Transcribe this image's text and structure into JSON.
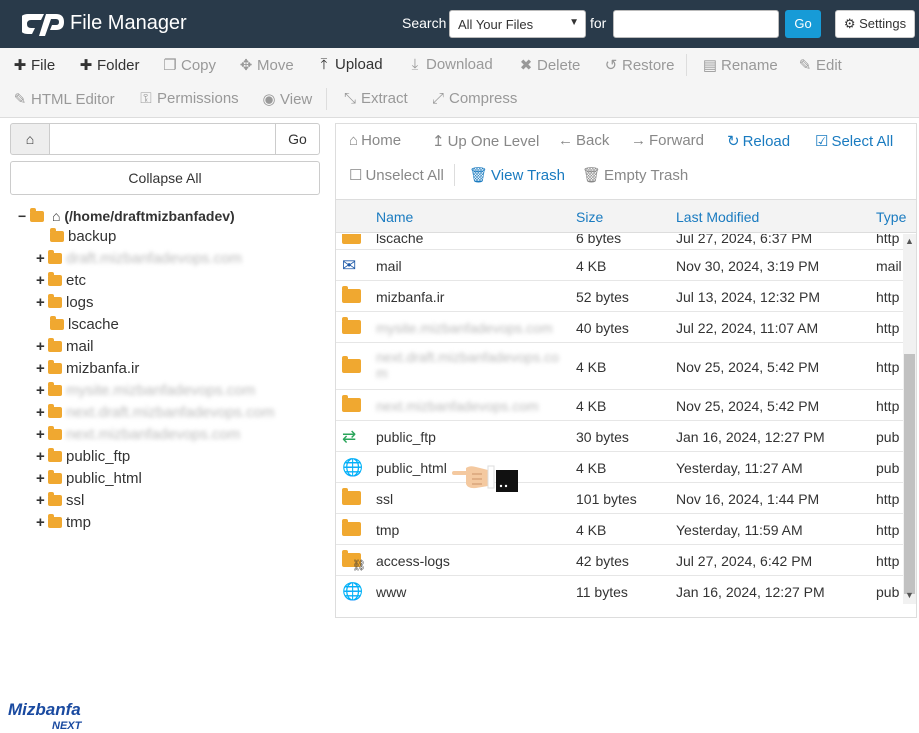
{
  "header": {
    "title": "File Manager",
    "search_label": "Search",
    "search_select": "All Your Files",
    "for_label": "for",
    "go_label": "Go",
    "settings_label": "Settings"
  },
  "toolbar": {
    "row1": [
      {
        "label": "File",
        "icon": "plus-icon",
        "state": "active"
      },
      {
        "label": "Folder",
        "icon": "plus-icon",
        "state": "active"
      },
      {
        "label": "Copy",
        "icon": "copy-icon",
        "state": "disabled"
      },
      {
        "label": "Move",
        "icon": "move-icon",
        "state": "disabled"
      },
      {
        "label": "Upload",
        "icon": "upload-icon",
        "state": "active"
      },
      {
        "label": "Download",
        "icon": "download-icon",
        "state": "disabled"
      },
      {
        "label": "Delete",
        "icon": "delete-icon",
        "state": "disabled"
      },
      {
        "label": "Restore",
        "icon": "restore-icon",
        "state": "disabled"
      },
      {
        "label": "Rename",
        "icon": "rename-icon",
        "state": "disabled"
      },
      {
        "label": "Edit",
        "icon": "edit-icon",
        "state": "disabled"
      }
    ],
    "row2": [
      {
        "label": "HTML Editor",
        "icon": "html-editor-icon",
        "state": "disabled"
      },
      {
        "label": "Permissions",
        "icon": "key-icon",
        "state": "disabled"
      },
      {
        "label": "View",
        "icon": "eye-icon",
        "state": "disabled"
      },
      {
        "label": "Extract",
        "icon": "extract-icon",
        "state": "disabled"
      },
      {
        "label": "Compress",
        "icon": "compress-icon",
        "state": "disabled"
      }
    ]
  },
  "left": {
    "go_label": "Go",
    "collapse_label": "Collapse All",
    "root": "(/home/draftmizbanfadev)",
    "items": [
      {
        "label": "backup",
        "expandable": false,
        "blurred": false
      },
      {
        "label": "draft.mizbanfadevops.com",
        "expandable": true,
        "blurred": true
      },
      {
        "label": "etc",
        "expandable": true,
        "blurred": false
      },
      {
        "label": "logs",
        "expandable": true,
        "blurred": false
      },
      {
        "label": "lscache",
        "expandable": false,
        "blurred": false
      },
      {
        "label": "mail",
        "expandable": true,
        "blurred": false
      },
      {
        "label": "mizbanfa.ir",
        "expandable": true,
        "blurred": false
      },
      {
        "label": "mysite.mizbanfadevops.com",
        "expandable": true,
        "blurred": true
      },
      {
        "label": "next.draft.mizbanfadevops.com",
        "expandable": true,
        "blurred": true
      },
      {
        "label": "next.mizbanfadevops.com",
        "expandable": true,
        "blurred": true
      },
      {
        "label": "public_ftp",
        "expandable": true,
        "blurred": false
      },
      {
        "label": "public_html",
        "expandable": true,
        "blurred": false
      },
      {
        "label": "ssl",
        "expandable": true,
        "blurred": false
      },
      {
        "label": "tmp",
        "expandable": true,
        "blurred": false
      }
    ],
    "brand": "Mizbanfa",
    "brand_sub": "NEXT"
  },
  "actions": {
    "row1": [
      {
        "label": "Home",
        "icon": "home-icon",
        "color": "grey"
      },
      {
        "label": "Up One Level",
        "icon": "up-level-icon",
        "color": "grey"
      },
      {
        "label": "Back",
        "icon": "back-arrow-icon",
        "color": "grey"
      },
      {
        "label": "Forward",
        "icon": "forward-arrow-icon",
        "color": "grey"
      },
      {
        "label": "Reload",
        "icon": "reload-icon",
        "color": "blue"
      },
      {
        "label": "Select All",
        "icon": "check-square-icon",
        "color": "blue"
      }
    ],
    "row2": [
      {
        "label": "Unselect All",
        "icon": "square-icon",
        "color": "grey"
      },
      {
        "label": "View Trash",
        "icon": "trash-icon",
        "color": "blue"
      },
      {
        "label": "Empty Trash",
        "icon": "trash-icon",
        "color": "grey"
      }
    ]
  },
  "grid": {
    "headers": {
      "name": "Name",
      "size": "Size",
      "modified": "Last Modified",
      "type": "Type"
    },
    "rows": [
      {
        "name": "lscache",
        "size": "6 bytes",
        "modified": "Jul 27, 2024, 6:37 PM",
        "type": "http",
        "icon": "folder-icon",
        "blurred": false
      },
      {
        "name": "mail",
        "size": "4 KB",
        "modified": "Nov 30, 2024, 3:19 PM",
        "type": "mail",
        "icon": "envelope-icon",
        "blurred": false
      },
      {
        "name": "mizbanfa.ir",
        "size": "52 bytes",
        "modified": "Jul 13, 2024, 12:32 PM",
        "type": "http",
        "icon": "folder-icon",
        "blurred": false
      },
      {
        "name": "mysite.mizbanfadevops.com",
        "size": "40 bytes",
        "modified": "Jul 22, 2024, 11:07 AM",
        "type": "http",
        "icon": "folder-icon",
        "blurred": true
      },
      {
        "name": "next.draft.mizbanfadevops.co m",
        "size": "4 KB",
        "modified": "Nov 25, 2024, 5:42 PM",
        "type": "http",
        "icon": "folder-icon",
        "blurred": true
      },
      {
        "name": "next.mizbanfadevops.com",
        "size": "4 KB",
        "modified": "Nov 25, 2024, 5:42 PM",
        "type": "http",
        "icon": "folder-icon",
        "blurred": true
      },
      {
        "name": "public_ftp",
        "size": "30 bytes",
        "modified": "Jan 16, 2024, 12:27 PM",
        "type": "pub",
        "icon": "exchange-icon",
        "blurred": false
      },
      {
        "name": "public_html",
        "size": "4 KB",
        "modified": "Yesterday, 11:27 AM",
        "type": "pub",
        "icon": "globe-icon",
        "blurred": false
      },
      {
        "name": "ssl",
        "size": "101 bytes",
        "modified": "Nov 16, 2024, 1:44 PM",
        "type": "http",
        "icon": "folder-icon",
        "blurred": false
      },
      {
        "name": "tmp",
        "size": "4 KB",
        "modified": "Yesterday, 11:59 AM",
        "type": "http",
        "icon": "folder-icon",
        "blurred": false
      },
      {
        "name": "access-logs",
        "size": "42 bytes",
        "modified": "Jul 27, 2024, 6:42 PM",
        "type": "http",
        "icon": "folder-link-icon",
        "blurred": false
      },
      {
        "name": "www",
        "size": "11 bytes",
        "modified": "Jan 16, 2024, 12:27 PM",
        "type": "pub",
        "icon": "globe-icon",
        "blurred": false
      }
    ]
  },
  "colors": {
    "header_bg": "#293a4a",
    "accent": "#179bd7",
    "link": "#1a7bc0",
    "folder": "#f0a830"
  }
}
